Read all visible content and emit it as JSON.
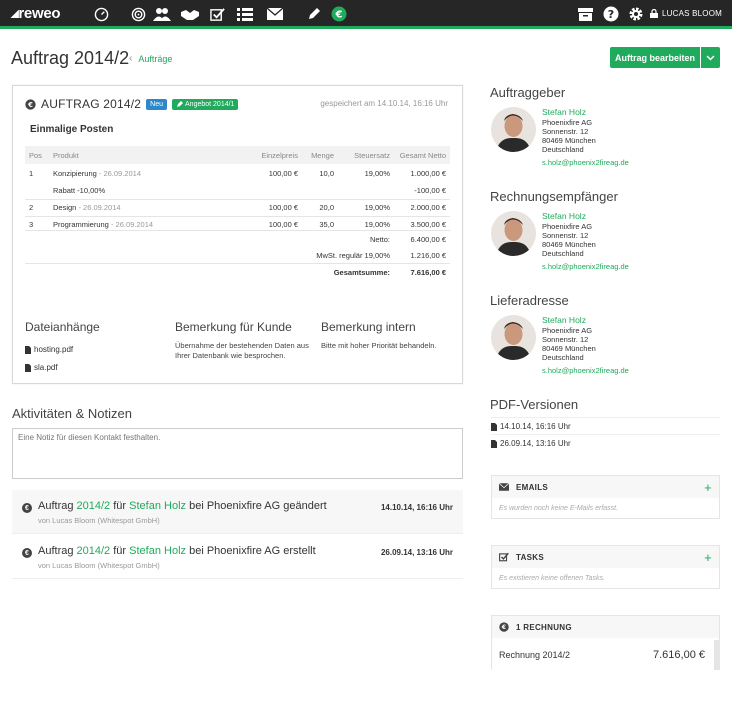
{
  "topbar": {
    "logo": "reweo",
    "icons": [
      "dashboard-icon",
      "target-icon",
      "contacts-icon",
      "handshake-icon",
      "checkbox-icon",
      "list-icon",
      "mail-icon",
      "pen-icon",
      "euro-icon"
    ],
    "right_icons": [
      "archive-icon",
      "help-icon",
      "gear-icon",
      "lock-icon"
    ],
    "user": "LUCAS BLOOM",
    "accent": "#1faa5c"
  },
  "header": {
    "title": "Auftrag 2014/2",
    "breadcrumb": "Aufträge",
    "edit_button": "Auftrag bearbeiten"
  },
  "order": {
    "title": "AUFTRAG 2014/2",
    "badge_new": "Neu",
    "badge_offer": "Angebot 2014/1",
    "saved": "gespeichert am 14.10.14, 16:16 Uhr",
    "section": "Einmalige Posten",
    "columns": [
      "Pos",
      "Produkt",
      "Einzelpreis",
      "Menge",
      "Steuersatz",
      "Gesamt Netto"
    ],
    "rows": [
      {
        "pos": "1",
        "product": "Konzipierung",
        "date": "- 26.09.2014",
        "price": "100,00 €",
        "qty": "10,0",
        "tax": "19,00%",
        "total": "1.000,00 €"
      },
      {
        "discount": "Rabatt -10,00%",
        "discount_total": "-100,00 €"
      },
      {
        "pos": "2",
        "product": "Design",
        "date": "- 26.09.2014",
        "price": "100,00 €",
        "qty": "20,0",
        "tax": "19,00%",
        "total": "2.000,00 €"
      },
      {
        "pos": "3",
        "product": "Programmierung",
        "date": "- 26.09.2014",
        "price": "100,00 €",
        "qty": "35,0",
        "tax": "19,00%",
        "total": "3.500,00 €"
      }
    ],
    "netto_label": "Netto:",
    "netto": "6.400,00 €",
    "vat_label": "MwSt. regulär 19,00%",
    "vat": "1.216,00 €",
    "sum_label": "Gesamtsumme:",
    "sum": "7.616,00 €",
    "attachments_h": "Dateianhänge",
    "files": [
      "hosting.pdf",
      "sla.pdf"
    ],
    "customer_note_h": "Bemerkung für Kunde",
    "customer_note": "Übernahme der bestehenden Daten aus Ihrer Datenbank wie besprochen.",
    "internal_note_h": "Bemerkung intern",
    "internal_note": "Bitte mit hoher Priorität behandeln."
  },
  "activities": {
    "heading": "Aktivitäten & Notizen",
    "placeholder": "Eine Notiz für diesen Kontakt festhalten.",
    "items": [
      {
        "w1": "Auftrag",
        "ref": "2014/2",
        "w2": "für",
        "person": "Stefan Holz",
        "w3": "bei Phoenixfire AG geändert",
        "by": "von Lucas Bloom (Whitespot GmbH)",
        "date": "14.10.14, 16:16 Uhr"
      },
      {
        "w1": "Auftrag",
        "ref": "2014/2",
        "w2": "für",
        "person": "Stefan Holz",
        "w3": "bei Phoenixfire AG erstellt",
        "by": "von Lucas Bloom (Whitespot GmbH)",
        "date": "26.09.14, 13:16 Uhr"
      }
    ]
  },
  "contacts": [
    {
      "heading": "Auftraggeber",
      "name": "Stefan Holz",
      "company": "Phoenixfire AG",
      "street": "Sonnenstr. 12",
      "city": "80469 München",
      "country": "Deutschland",
      "email": "s.holz@phoenix2fireag.de"
    },
    {
      "heading": "Rechnungsempfänger",
      "name": "Stefan Holz",
      "company": "Phoenixfire AG",
      "street": "Sonnenstr. 12",
      "city": "80469 München",
      "country": "Deutschland",
      "email": "s.holz@phoenix2fireag.de"
    },
    {
      "heading": "Lieferadresse",
      "name": "Stefan Holz",
      "company": "Phoenixfire AG",
      "street": "Sonnenstr. 12",
      "city": "80469 München",
      "country": "Deutschland",
      "email": "s.holz@phoenix2fireag.de"
    }
  ],
  "pdf": {
    "heading": "PDF-Versionen",
    "versions": [
      "14.10.14, 16:16 Uhr",
      "26.09.14, 13:16 Uhr"
    ]
  },
  "emails": {
    "title": "EMAILS",
    "empty": "Es wurden noch keine E-Mails erfasst."
  },
  "tasks": {
    "title": "TASKS",
    "empty": "Es existieren keine offenen Tasks."
  },
  "invoices": {
    "title": "1 RECHNUNG",
    "item": "Rechnung 2014/2",
    "amount": "7.616,00 €"
  }
}
